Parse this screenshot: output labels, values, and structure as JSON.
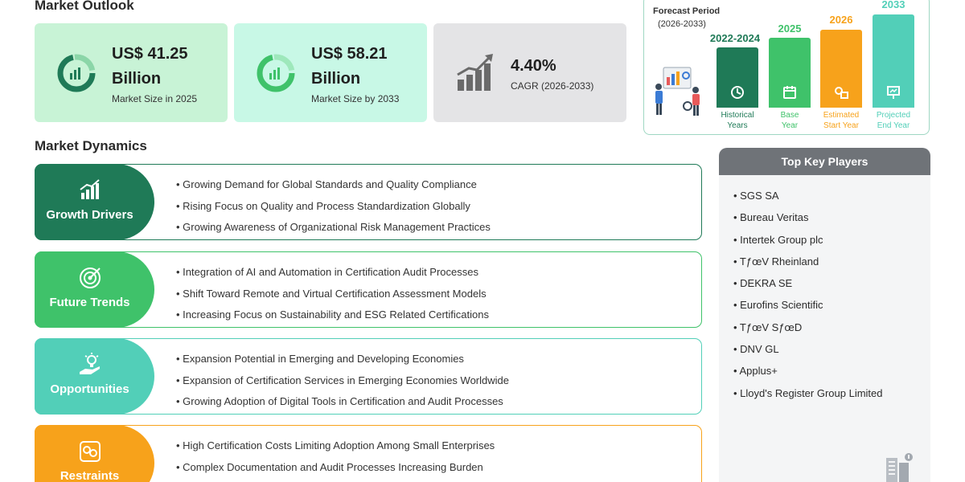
{
  "outlook": {
    "title": "Market Outlook",
    "cards": [
      {
        "value": "US$ 41.25 Billion",
        "label": "Market Size in 2025",
        "icon": "donut-chart-icon"
      },
      {
        "value": "US$ 58.21 Billion",
        "label": "Market Size by 2033",
        "icon": "donut-chart-icon"
      },
      {
        "value": "4.40%",
        "label": "CAGR (2026-2033)",
        "icon": "growth-bars-icon"
      }
    ]
  },
  "forecast": {
    "label": "Forecast Period",
    "range": "(2026-2033)",
    "bars": [
      {
        "year": "2022-2024",
        "caption_1": "Historical",
        "caption_2": "Years",
        "color": "#1f7a57",
        "icon": "history-icon"
      },
      {
        "year": "2025",
        "caption_1": "Base",
        "caption_2": "Year",
        "color": "#3fc26a",
        "icon": "calendar-icon"
      },
      {
        "year": "2026",
        "caption_1": "Estimated",
        "caption_2": "Start Year",
        "color": "#f7a21b",
        "icon": "estimate-icon"
      },
      {
        "year": "2033",
        "caption_1": "Projected",
        "caption_2": "End Year",
        "color": "#52cfb8",
        "icon": "presentation-icon"
      }
    ]
  },
  "dynamics": {
    "title": "Market Dynamics",
    "rows": [
      {
        "label": "Growth Drivers",
        "color": "#1f7a57",
        "border": "#1f7a57",
        "icon": "growth-chart-icon",
        "points": [
          "• Growing Demand for Global Standards and Quality Compliance",
          "• Rising Focus on Quality and Process Standardization Globally",
          "• Growing Awareness of Organizational Risk Management Practices"
        ]
      },
      {
        "label": "Future Trends",
        "color": "#3fc26a",
        "border": "#3fc26a",
        "icon": "target-icon",
        "points": [
          "• Integration of AI and Automation in Certification Audit Processes",
          "• Shift Toward Remote and Virtual Certification Assessment Models",
          "• Increasing Focus on Sustainability and ESG Related Certifications"
        ]
      },
      {
        "label": "Opportunities",
        "color": "#52cfb8",
        "border": "#52cfb8",
        "icon": "idea-hand-icon",
        "points": [
          "• Expansion Potential in Emerging and Developing Economies",
          "• Expansion of Certification Services in Emerging Economies Worldwide",
          "• Growing Adoption of Digital Tools in Certification and Audit Processes"
        ]
      },
      {
        "label": "Restraints",
        "color": "#f7a21b",
        "border": "#f7a21b",
        "icon": "restraint-icon",
        "points": [
          "• High Certification Costs Limiting Adoption Among Small Enterprises",
          "• Complex Documentation and Audit Processes Increasing Burden",
          ""
        ]
      }
    ]
  },
  "key_players": {
    "title": "Top Key Players",
    "items": [
      "• SGS SA",
      "• Bureau Veritas",
      "• Intertek Group plc",
      "• TƒœV Rheinland",
      "• DEKRA SE",
      "• Eurofins Scientific",
      "• TƒœV SƒœD",
      "• DNV GL",
      "• Applus+",
      "• Lloyd's Register Group Limited"
    ]
  }
}
